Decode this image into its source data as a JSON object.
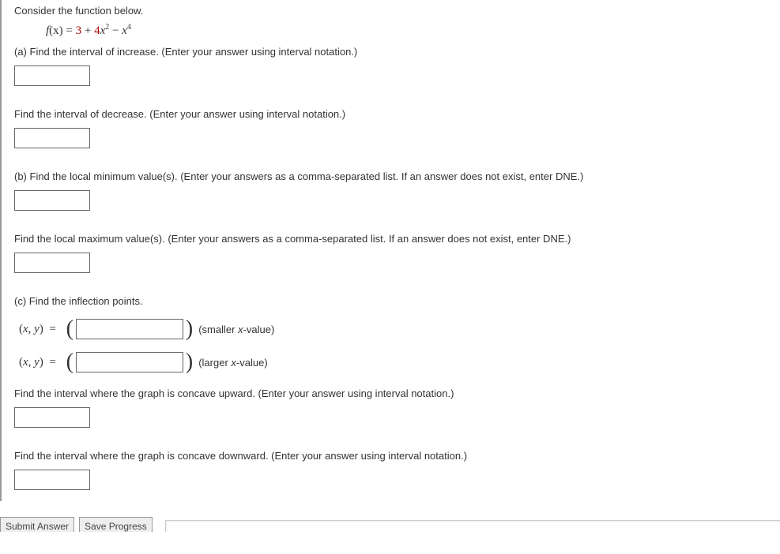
{
  "intro": "Consider the function below.",
  "formula_parts": {
    "fx": "f",
    "openx": "(x) = ",
    "c1": "3",
    "plus": " + ",
    "c2": "4",
    "x2": "x",
    "minus": " − ",
    "x4": "x"
  },
  "parts": {
    "a1": "(a) Find the interval of increase. (Enter your answer using interval notation.)",
    "a2": "Find the interval of decrease. (Enter your answer using interval notation.)",
    "b1": "(b) Find the local minimum value(s). (Enter your answers as a comma-separated list. If an answer does not exist, enter DNE.)",
    "b2": "Find the local maximum value(s). (Enter your answers as a comma-separated list. If an answer does not exist, enter DNE.)",
    "c_head": "(c) Find the inflection points.",
    "xy_label": "(x, y)  =  ",
    "hint_small_pre": "(smaller ",
    "hint_small_var": "x",
    "hint_small_post": "-value)",
    "hint_large_pre": "(larger ",
    "hint_large_var": "x",
    "hint_large_post": "-value)",
    "c2": "Find the interval where the graph is concave upward. (Enter your answer using interval notation.)",
    "c3": "Find the interval where the graph is concave downward. (Enter your answer using interval notation.)"
  },
  "buttons": {
    "submit": "Submit Answer",
    "save": "Save Progress"
  }
}
